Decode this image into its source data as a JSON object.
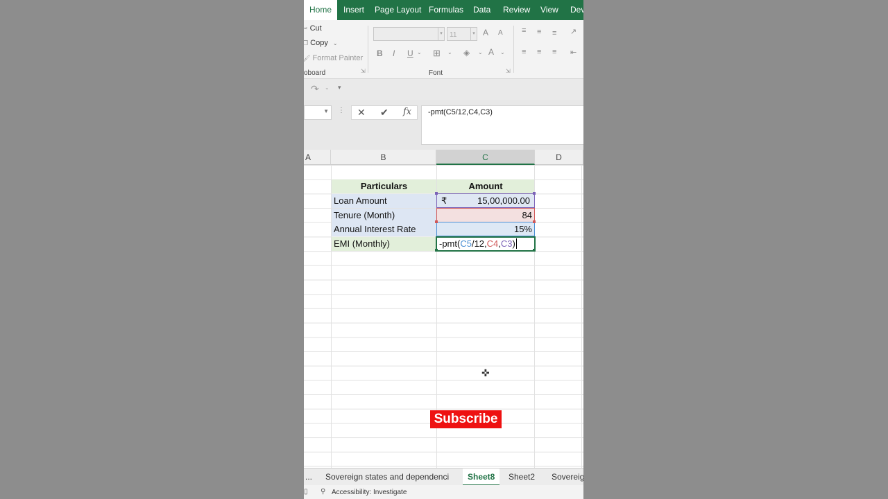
{
  "ribbon": {
    "tabs": [
      "Home",
      "Insert",
      "Page Layout",
      "Formulas",
      "Data",
      "Review",
      "View",
      "Dev"
    ],
    "clipboard": {
      "cut": "Cut",
      "copy": "Copy",
      "format_painter": "Format Painter",
      "group_label": "oboard"
    },
    "font": {
      "font_name": "",
      "font_size": "11",
      "bold": "B",
      "italic": "I",
      "underline": "U",
      "group_label": "Font",
      "font_color": "A",
      "grow": "A",
      "shrink": "A"
    }
  },
  "formula_bar": {
    "name_box": "",
    "cancel": "✕",
    "enter": "✔",
    "fx": "fx",
    "formula": "-pmt(C5/12,C4,C3)"
  },
  "columns": [
    "A",
    "B",
    "C",
    "D"
  ],
  "table": {
    "header_particulars": "Particulars",
    "header_amount": "Amount",
    "rows": [
      {
        "label": "Loan Amount",
        "currency": "₹",
        "value": "15,00,000.00"
      },
      {
        "label": "Tenure (Month)",
        "value": "84"
      },
      {
        "label": "Annual Interest Rate",
        "value": "15%"
      },
      {
        "label": "EMI (Monthly)"
      }
    ],
    "edit_parts": {
      "p1": "-pmt(",
      "r1": "C5",
      "p2": "/12,",
      "r2": "C4",
      "p3": ",",
      "r3": "C3",
      "p4": ")"
    }
  },
  "overlay": {
    "subscribe": "Subscribe"
  },
  "sheets": {
    "more": "...",
    "tabs": [
      "Sovereign states and dependenci",
      "Sheet8",
      "Sheet2",
      "Sovereig"
    ],
    "active": "Sheet8"
  },
  "status": {
    "accessibility": "Accessibility: Investigate"
  },
  "colors": {
    "excel_green": "#217346",
    "ref_c5": "#4a8fd4",
    "ref_c4": "#d05858",
    "ref_c3": "#7c63b8",
    "subscribe_red": "#ee1111"
  }
}
